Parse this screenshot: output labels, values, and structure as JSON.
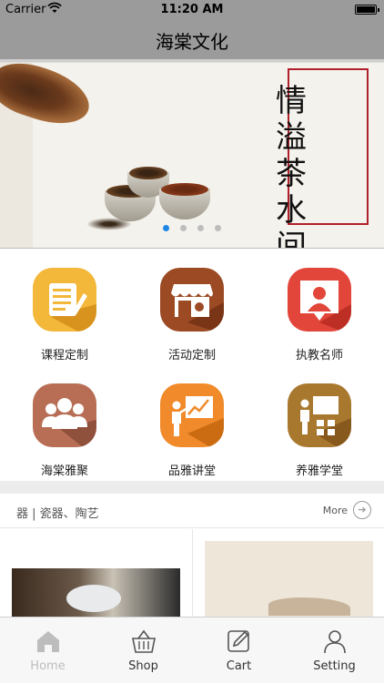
{
  "status_bar": {
    "carrier": "Carrier",
    "time": "11:20 AM"
  },
  "nav": {
    "title": "海棠文化"
  },
  "banner": {
    "text_chars": [
      "情",
      "溢",
      "茶",
      "水",
      "间"
    ],
    "page_count": 4,
    "active_page": 1
  },
  "grid": {
    "items": [
      {
        "label": "课程定制",
        "icon": "course-list-icon",
        "color": "#f3b73a"
      },
      {
        "label": "活动定制",
        "icon": "shop-stall-icon",
        "color": "#9b4a24"
      },
      {
        "label": "执教名师",
        "icon": "teacher-badge-icon",
        "color": "#e2463a"
      },
      {
        "label": "海棠雅聚",
        "icon": "group-icon",
        "color": "#b76e55"
      },
      {
        "label": "品雅讲堂",
        "icon": "presentation-icon",
        "color": "#f08a2a"
      },
      {
        "label": "养雅学堂",
        "icon": "classroom-icon",
        "color": "#a8782e"
      }
    ]
  },
  "section": {
    "title": "器 | 瓷器、陶艺",
    "more_label": "More"
  },
  "tabbar": {
    "items": [
      {
        "label": "Home",
        "icon": "home-icon",
        "selected": false
      },
      {
        "label": "Shop",
        "icon": "basket-icon",
        "selected": false
      },
      {
        "label": "Cart",
        "icon": "edit-icon",
        "selected": false
      },
      {
        "label": "Setting",
        "icon": "person-icon",
        "selected": false
      }
    ]
  }
}
